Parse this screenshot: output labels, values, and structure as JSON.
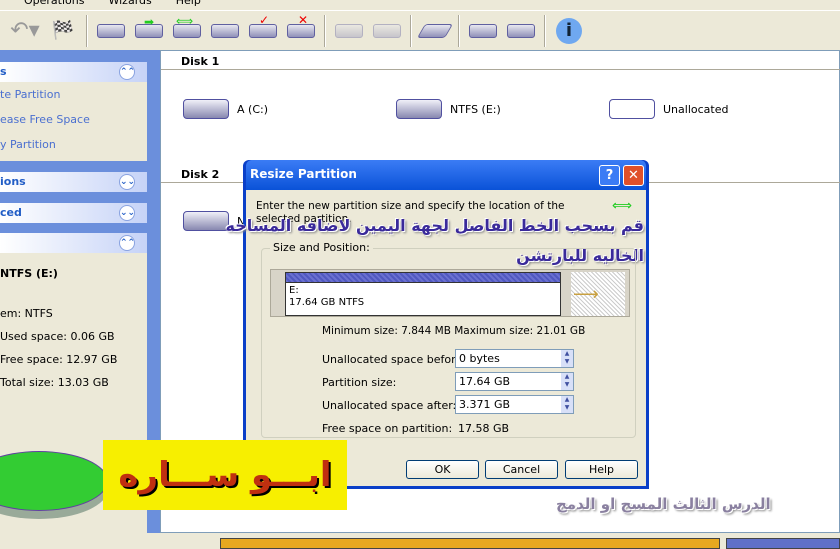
{
  "menu": [
    "Operations",
    "Wizards",
    "Help"
  ],
  "toolbar": [
    {
      "name": "undo-icon",
      "glyph": "↶"
    },
    {
      "name": "apply-flag-icon",
      "glyph": "🏁"
    },
    {
      "name": "copy-partition-icon"
    },
    {
      "name": "move-partition-icon"
    },
    {
      "name": "resize-partition-icon"
    },
    {
      "name": "format-partition-icon"
    },
    {
      "name": "check-partition-icon"
    },
    {
      "name": "delete-partition-icon"
    },
    {
      "name": "disabled-tool-1-icon"
    },
    {
      "name": "disabled-tool-2-icon"
    },
    {
      "name": "wipe-icon"
    },
    {
      "name": "properties-icon"
    },
    {
      "name": "explore-icon"
    },
    {
      "name": "info-icon",
      "glyph": "ℹ"
    }
  ],
  "sidebar": {
    "sections": [
      {
        "title": "s",
        "expanded": true,
        "items": [
          "te Partition",
          "ease Free Space",
          "y Partition"
        ]
      },
      {
        "title": "ions",
        "expanded": false
      },
      {
        "title": "ced",
        "expanded": false
      },
      {
        "title": "",
        "expanded": true
      }
    ],
    "details": {
      "name": "NTFS (E:)",
      "fs": "em: NTFS",
      "used": "Used space:  0.06 GB",
      "free": "Free space:  12.97 GB",
      "total": "Total size:     13.03 GB"
    }
  },
  "main": {
    "disk1": "Disk 1",
    "disk2": "Disk 2",
    "volumes": [
      "A (C:)",
      "NTFS (E:)",
      "Unallocated"
    ],
    "disk2_vol": "NT"
  },
  "dialog": {
    "title": "Resize Partition",
    "instructions": "Enter the new partition size and specify the location of the selected partition.",
    "group": "Size and Position:",
    "part_letter": "E:",
    "part_info": "17.64 GB  NTFS",
    "minmax": "Minimum size: 7.844 MB   Maximum size: 21.01 GB",
    "fields": [
      {
        "label": "Unallocated space before:",
        "value": "0 bytes"
      },
      {
        "label": "Partition size:",
        "value": "17.64 GB"
      },
      {
        "label": "Unallocated space after:",
        "value": "3.371 GB"
      }
    ],
    "free_label": "Free space on partition:",
    "free_value": "17.58 GB",
    "ok": "OK",
    "cancel": "Cancel",
    "help": "Help"
  },
  "overlay": {
    "instruction_ar_1": "قم بسحب الخط الفاصل لجهة اليمين لاضافه المساحه",
    "instruction_ar_2": "الخاليه للبارتشن",
    "author": "ابـــو ســـاره",
    "lesson": "الدرس الثالث المسح او الدمج"
  },
  "colors": {
    "sidebar": "#6b8fdc",
    "titlebar": "#0a52d8",
    "banner": "#f7ef00",
    "pie": "#33cc33"
  }
}
